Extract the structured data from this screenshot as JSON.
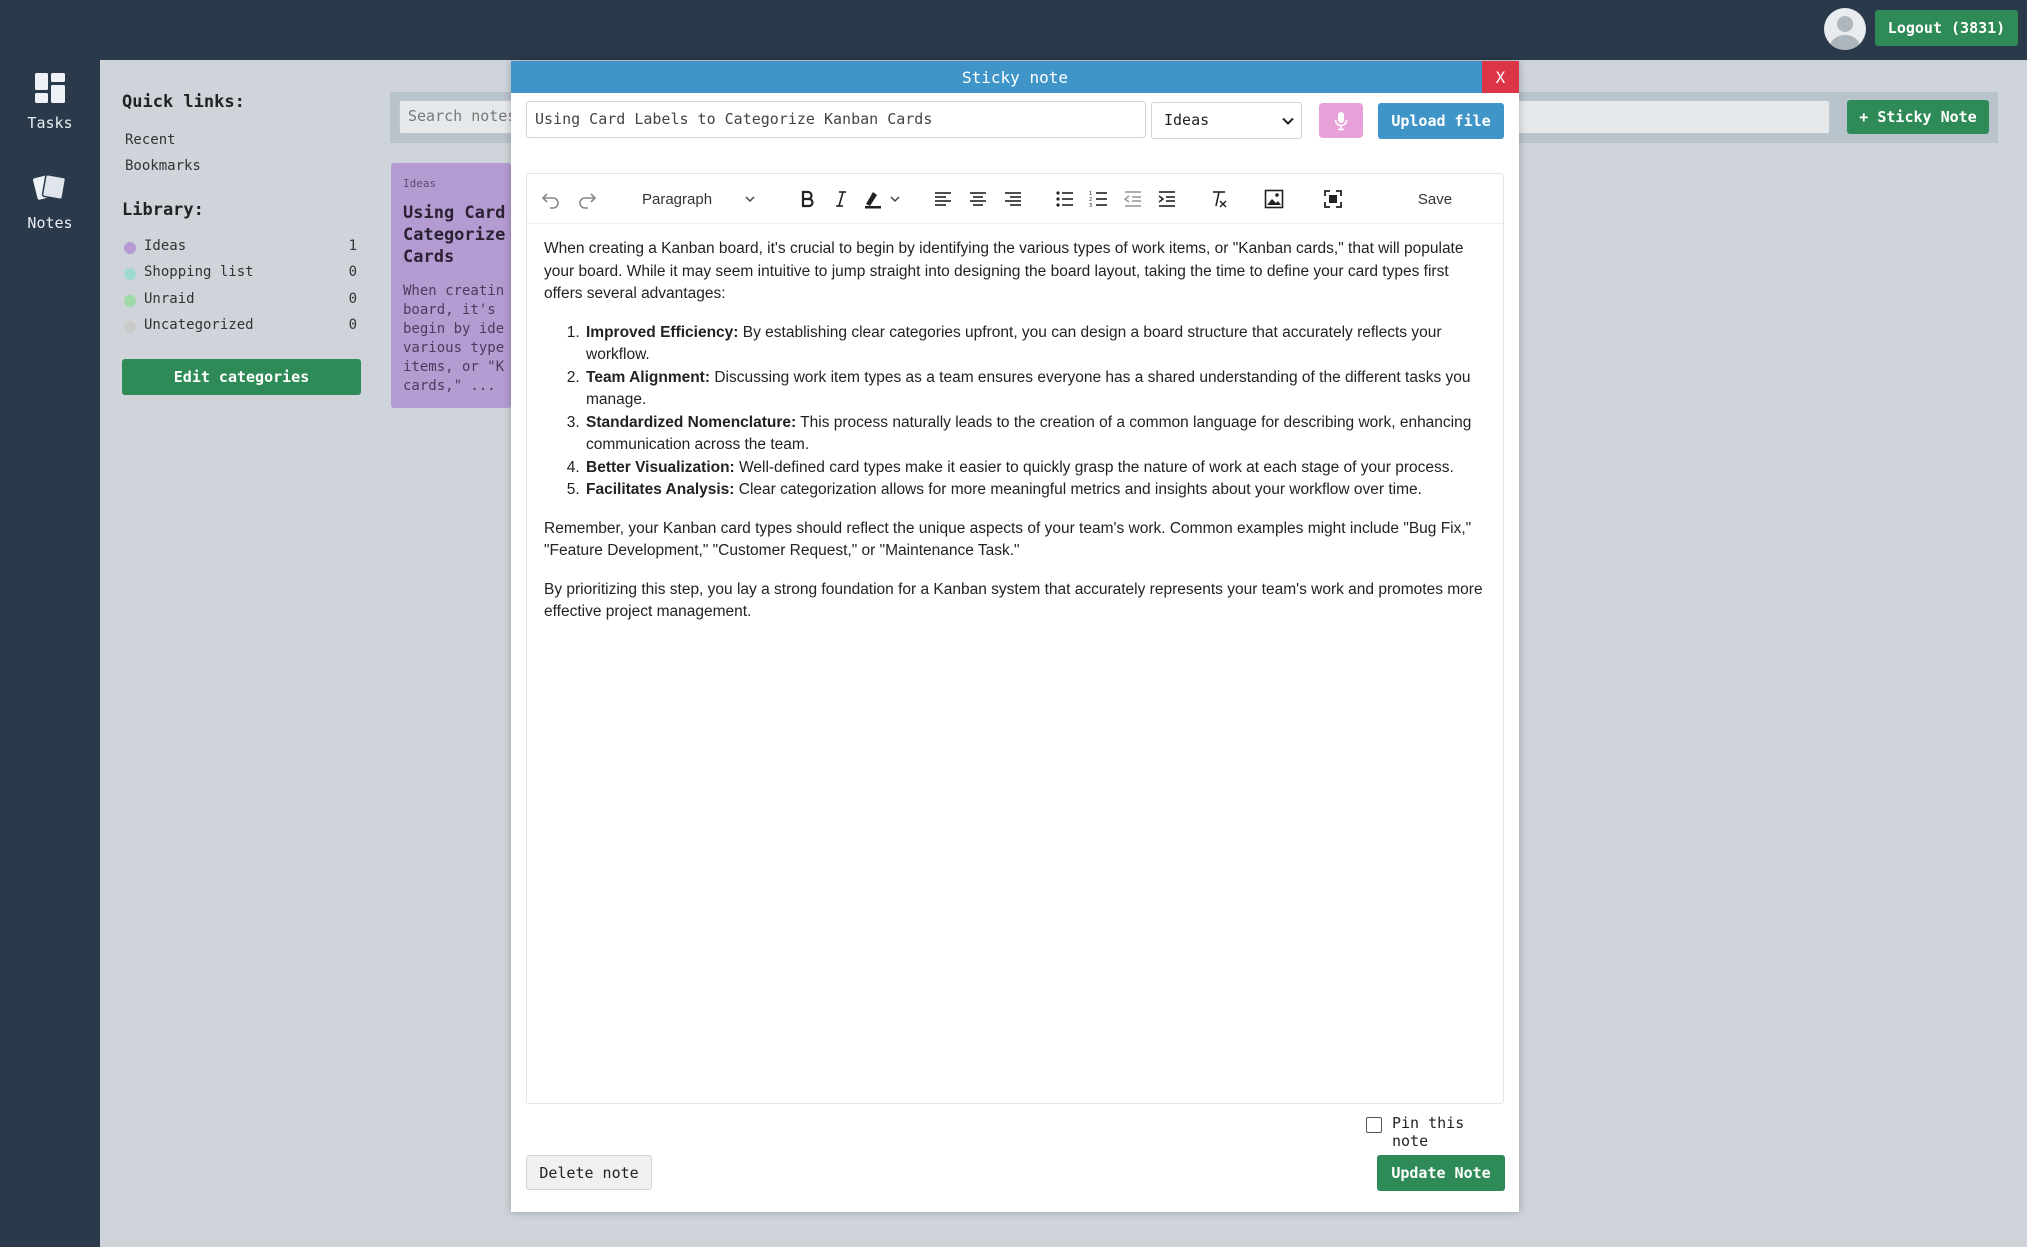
{
  "header": {
    "avatar_icon": "user-avatar-icon",
    "logout_label": "Logout (3831)"
  },
  "rail": {
    "items": [
      {
        "label": "Tasks",
        "icon": "tasks-dashboard-icon"
      },
      {
        "label": "Notes",
        "icon": "notes-stack-icon"
      }
    ]
  },
  "sidebar": {
    "quick_links_title": "Quick links:",
    "quick_links": [
      "Recent",
      "Bookmarks"
    ],
    "library_title": "Library:",
    "library": [
      {
        "name": "Ideas",
        "count": "1",
        "color": "#b49cd3"
      },
      {
        "name": "Shopping list",
        "count": "0",
        "color": "#9fd9d2"
      },
      {
        "name": "Unraid",
        "count": "0",
        "color": "#9fd9a8"
      },
      {
        "name": "Uncategorized",
        "count": "0",
        "color": "#c9c9c9"
      }
    ],
    "edit_categories_label": "Edit categories"
  },
  "notes_bar": {
    "search_placeholder": "Search notes",
    "new_sticky_label": "+ Sticky Note"
  },
  "note_card": {
    "category": "Ideas",
    "title": "Using Card\nCategorize\nCards",
    "excerpt": "When creatin\nboard, it's\nbegin by ide\nvarious type\nitems, or \"K\ncards,\" ...",
    "color": "#b49cd3"
  },
  "modal": {
    "header_title": "Sticky note",
    "close_label": "X",
    "title_value": "Using Card Labels to Categorize Kanban Cards",
    "category_value": "Ideas",
    "mic_icon": "microphone-icon",
    "upload_label": "Upload file",
    "toolbar": {
      "block_format": "Paragraph",
      "save_label": "Save"
    },
    "content": {
      "intro": "When creating a Kanban board, it's crucial to begin by identifying the various types of work items, or \"Kanban cards,\" that will populate your board. While it may seem intuitive to jump straight into designing the board layout, taking the time to define your card types first offers several advantages:",
      "list": [
        {
          "term": "Improved Efficiency:",
          "text": " By establishing clear categories upfront, you can design a board structure that accurately reflects your workflow."
        },
        {
          "term": "Team Alignment:",
          "text": " Discussing work item types as a team ensures everyone has a shared understanding of the different tasks you manage."
        },
        {
          "term": "Standardized Nomenclature:",
          "text": " This process naturally leads to the creation of a common language for describing work, enhancing communication across the team."
        },
        {
          "term": "Better Visualization:",
          "text": " Well-defined card types make it easier to quickly grasp the nature of work at each stage of your process."
        },
        {
          "term": "Facilitates Analysis:",
          "text": " Clear categorization allows for more meaningful metrics and insights about your workflow over time."
        }
      ],
      "para2": "Remember, your Kanban card types should reflect the unique aspects of your team's work. Common examples might include \"Bug Fix,\" \"Feature Development,\" \"Customer Request,\" or \"Maintenance Task.\"",
      "para3": "By prioritizing this step, you lay a strong foundation for a Kanban system that accurately represents your team's work and promotes more effective project management."
    },
    "pin_label": "Pin this note",
    "delete_label": "Delete note",
    "update_label": "Update Note"
  }
}
